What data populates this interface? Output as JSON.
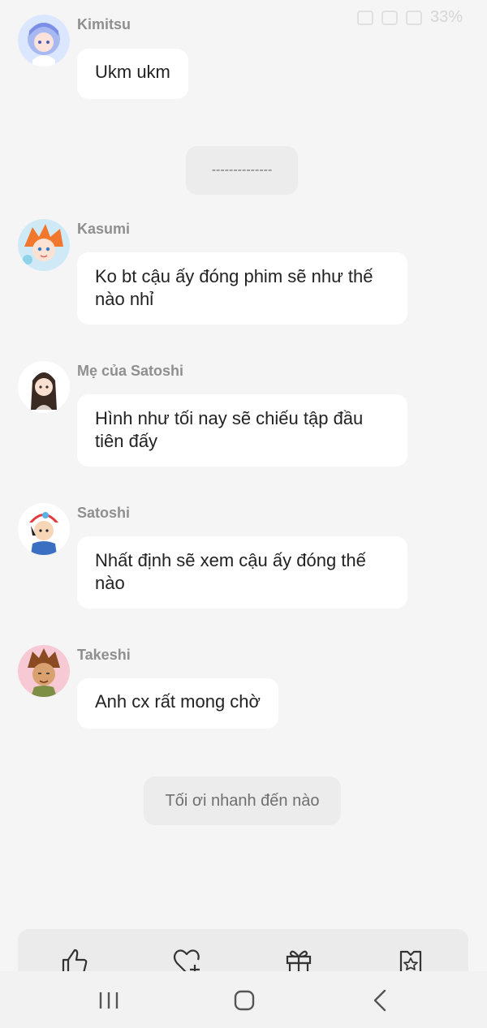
{
  "status_bar": {
    "battery": "33%",
    "icons": [
      "signal-icon",
      "wifi-icon",
      "mute-icon"
    ]
  },
  "messages": [
    {
      "sender": "Kimitsu",
      "text": "Ukm ukm",
      "avatar": "anime-girl-blue-avatar"
    },
    {
      "sender": "Kasumi",
      "text": "Ko bt cậu ấy đóng phim sẽ như thế nào nhỉ",
      "avatar": "anime-orange-hair-avatar"
    },
    {
      "sender": "Mẹ của Satoshi",
      "text": "Hình như tối nay sẽ chiếu tập đầu tiên đấy",
      "avatar": "anime-woman-avatar"
    },
    {
      "sender": "Satoshi",
      "text": "Nhất định sẽ xem cậu ấy đóng thế nào",
      "avatar": "anime-boy-cap-avatar"
    },
    {
      "sender": "Takeshi",
      "text": "Anh cx rất mong chờ",
      "avatar": "anime-brown-hair-avatar"
    }
  ],
  "system_messages": {
    "divider": "--------------",
    "narration": "Tối ơi nhanh đến nào"
  },
  "reaction_bar": {
    "icons": [
      "thumbs-up-icon",
      "heart-plus-icon",
      "gift-icon",
      "star-badge-icon"
    ]
  },
  "nav_bar": {
    "icons": [
      "recent-apps-icon",
      "home-icon",
      "back-icon"
    ]
  }
}
